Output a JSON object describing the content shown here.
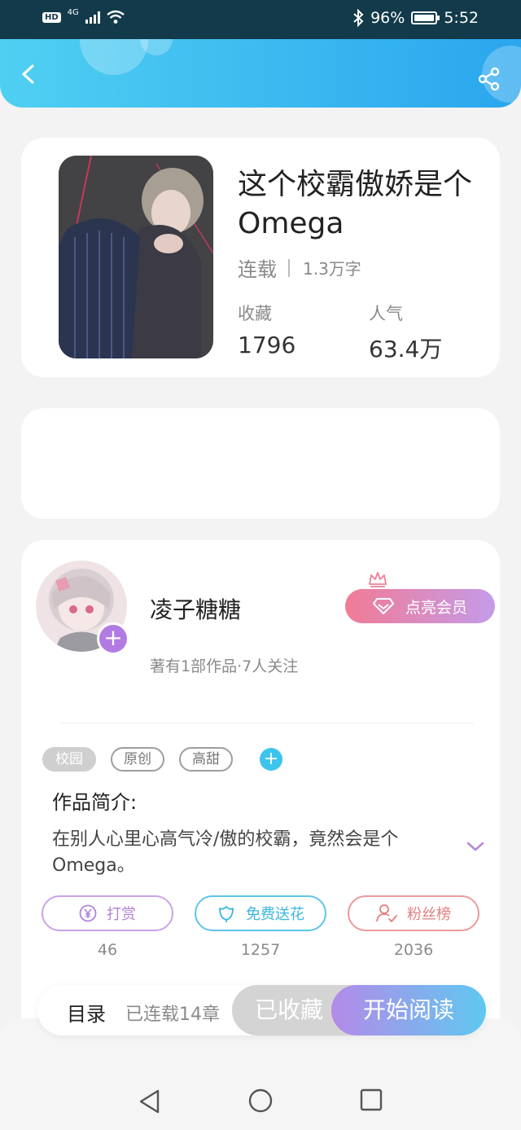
{
  "status_bar": {
    "network_badge": "HD",
    "network_type": "4G",
    "battery": "96%",
    "time": "5:52",
    "icons": [
      "hd-icon",
      "signal-icon",
      "wifi-icon",
      "bluetooth-icon",
      "battery-icon"
    ]
  },
  "header": {
    "back_icon": "chevron-left-icon",
    "share_icon": "share-icon",
    "accent_start": "#4fd0f2",
    "accent_end": "#2aa6ee"
  },
  "book": {
    "title": "这个校霸傲娇是个Omega",
    "status": "连载",
    "word_count": "1.3万字",
    "collect_label": "收藏",
    "collect_value": "1796",
    "popularity_label": "人气",
    "popularity_value": "63.4万"
  },
  "author": {
    "name": "凌子糖糖",
    "meta": "著有1部作品·7人关注",
    "follow_symbol": "+",
    "vip_label": "点亮会员"
  },
  "tags": [
    "校园",
    "原创",
    "高甜"
  ],
  "tag_add_symbol": "+",
  "intro": {
    "title": "作品简介:",
    "text": "在别人心里心高气冷/傲的校霸，竟然会是个Omega。"
  },
  "actions": [
    {
      "label": "打赏",
      "count": "46",
      "icon": "yen-coin-icon"
    },
    {
      "label": "免费送花",
      "count": "1257",
      "icon": "flower-icon"
    },
    {
      "label": "粉丝榜",
      "count": "2036",
      "icon": "fans-ranking-icon"
    }
  ],
  "bottom_bar": {
    "toc_label": "目录",
    "chapters": "已连载14章",
    "collected_label": "已收藏",
    "read_label": "开始阅读"
  },
  "nav": [
    "back-triangle-icon",
    "home-circle-icon",
    "recents-square-icon"
  ]
}
